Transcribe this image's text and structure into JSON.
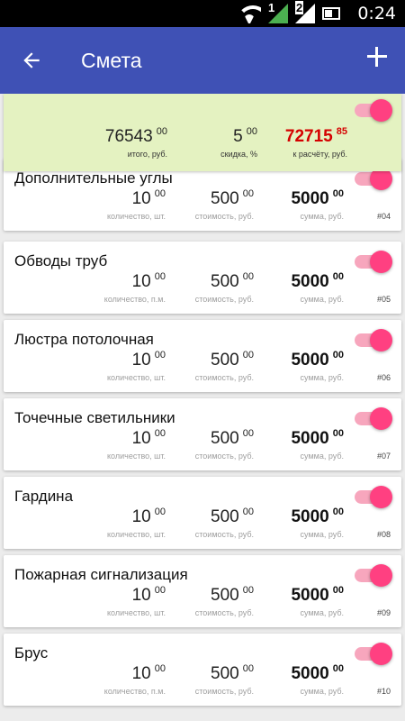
{
  "status": {
    "time": "0:24",
    "icons": [
      "wifi-icon",
      "signal-1-icon",
      "signal-2-icon",
      "battery-icon"
    ],
    "sim1": "1",
    "sim2": "2"
  },
  "appbar": {
    "title": "Смета",
    "back_icon": "arrow-left-icon",
    "add_icon": "plus-icon"
  },
  "colors": {
    "primary": "#3f51b5",
    "accent": "#ff4081",
    "summary_bg": "#e4f2c1",
    "total_red": "#d50000"
  },
  "summary": {
    "enabled": true,
    "total": {
      "int": "76543",
      "frac": "00",
      "label": "итого, руб."
    },
    "discount": {
      "int": "5",
      "frac": "00",
      "label": "скидка, %"
    },
    "payable": {
      "int": "72715",
      "frac": "85",
      "label": "к расчёту, руб."
    }
  },
  "items": [
    {
      "name": "Дополнительные углы",
      "qty": "10",
      "qty_frac": "00",
      "qty_label": "количество, шт.",
      "price": "500",
      "price_frac": "00",
      "price_label": "стоимость, руб.",
      "sum": "5000",
      "sum_frac": "00",
      "sum_label": "сумма, руб.",
      "num": "#04",
      "enabled": true
    },
    {
      "name": "Обводы труб",
      "qty": "10",
      "qty_frac": "00",
      "qty_label": "количество, п.м.",
      "price": "500",
      "price_frac": "00",
      "price_label": "стоимость, руб.",
      "sum": "5000",
      "sum_frac": "00",
      "sum_label": "сумма, руб.",
      "num": "#05",
      "enabled": true
    },
    {
      "name": "Люстра потолочная",
      "qty": "10",
      "qty_frac": "00",
      "qty_label": "количество, шт.",
      "price": "500",
      "price_frac": "00",
      "price_label": "стоимость, руб.",
      "sum": "5000",
      "sum_frac": "00",
      "sum_label": "сумма, руб.",
      "num": "#06",
      "enabled": true
    },
    {
      "name": "Точечные светильники",
      "qty": "10",
      "qty_frac": "00",
      "qty_label": "количество, шт.",
      "price": "500",
      "price_frac": "00",
      "price_label": "стоимость, руб.",
      "sum": "5000",
      "sum_frac": "00",
      "sum_label": "сумма, руб.",
      "num": "#07",
      "enabled": true
    },
    {
      "name": "Гардина",
      "qty": "10",
      "qty_frac": "00",
      "qty_label": "количество, шт.",
      "price": "500",
      "price_frac": "00",
      "price_label": "стоимость, руб.",
      "sum": "5000",
      "sum_frac": "00",
      "sum_label": "сумма, руб.",
      "num": "#08",
      "enabled": true
    },
    {
      "name": "Пожарная сигнализация",
      "qty": "10",
      "qty_frac": "00",
      "qty_label": "количество, шт.",
      "price": "500",
      "price_frac": "00",
      "price_label": "стоимость, руб.",
      "sum": "5000",
      "sum_frac": "00",
      "sum_label": "сумма, руб.",
      "num": "#09",
      "enabled": true
    },
    {
      "name": "Брус",
      "qty": "10",
      "qty_frac": "00",
      "qty_label": "количество, п.м.",
      "price": "500",
      "price_frac": "00",
      "price_label": "стоимость, руб.",
      "sum": "5000",
      "sum_frac": "00",
      "sum_label": "сумма, руб.",
      "num": "#10",
      "enabled": true
    }
  ]
}
